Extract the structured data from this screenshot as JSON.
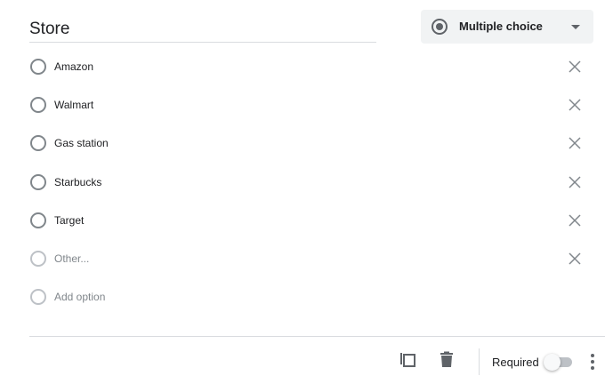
{
  "question": {
    "title": "Store",
    "type_label": "Multiple choice"
  },
  "options": [
    {
      "label": "Amazon"
    },
    {
      "label": "Walmart"
    },
    {
      "label": "Gas station"
    },
    {
      "label": "Starbucks"
    },
    {
      "label": "Target"
    }
  ],
  "other_option": {
    "label": "Other..."
  },
  "add_option": {
    "label": "Add option"
  },
  "footer": {
    "required_label": "Required",
    "required_on": false
  },
  "icons": {
    "type": "radio-button-checked-icon",
    "dropdown": "caret-down-icon",
    "remove": "close-icon",
    "duplicate": "copy-icon",
    "delete": "trash-icon",
    "more": "more-vert-icon"
  },
  "colors": {
    "text": "#202124",
    "muted": "#80868b",
    "icon": "#5f6368",
    "dropdown_bg": "#f1f3f4",
    "divider": "#dadce0"
  }
}
